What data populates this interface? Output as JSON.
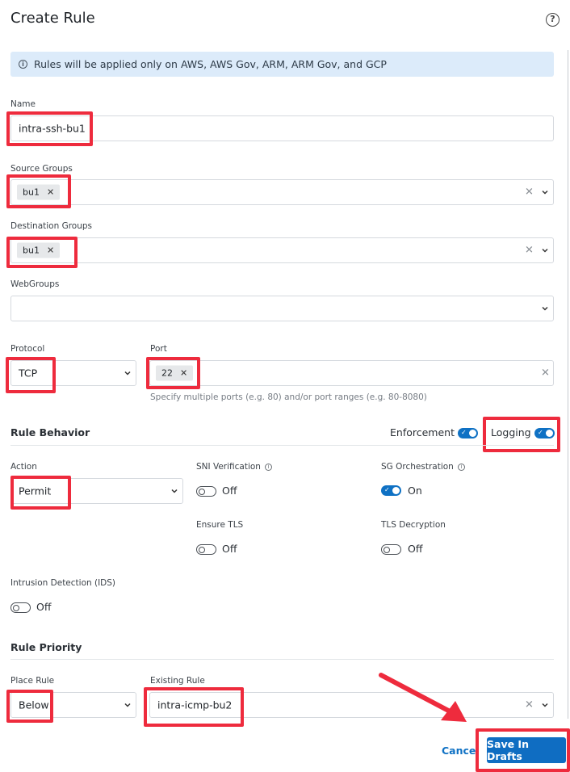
{
  "header": {
    "title": "Create Rule",
    "help_icon": "?"
  },
  "banner": {
    "icon": "info-icon",
    "text": "Rules will be applied only on AWS, AWS Gov, ARM, ARM Gov, and GCP"
  },
  "name": {
    "label": "Name",
    "value": "intra-ssh-bu1"
  },
  "source_groups": {
    "label": "Source Groups",
    "chips": [
      "bu1"
    ]
  },
  "destination_groups": {
    "label": "Destination Groups",
    "chips": [
      "bu1"
    ]
  },
  "webgroups": {
    "label": "WebGroups",
    "value": ""
  },
  "protocol": {
    "label": "Protocol",
    "value": "TCP"
  },
  "port": {
    "label": "Port",
    "chips": [
      "22"
    ],
    "hint": "Specify multiple ports (e.g. 80) and/or port ranges (e.g. 80-8080)"
  },
  "rule_behavior": {
    "title": "Rule Behavior",
    "enforcement": {
      "label": "Enforcement",
      "on": true
    },
    "logging": {
      "label": "Logging",
      "on": true
    }
  },
  "action": {
    "label": "Action",
    "value": "Permit"
  },
  "sni_verification": {
    "label": "SNI Verification",
    "state": "Off",
    "on": false
  },
  "sg_orchestration": {
    "label": "SG Orchestration",
    "state": "On",
    "on": true
  },
  "ensure_tls": {
    "label": "Ensure TLS",
    "state": "Off",
    "on": false
  },
  "tls_decryption": {
    "label": "TLS Decryption",
    "state": "Off",
    "on": false
  },
  "ids": {
    "label": "Intrusion Detection (IDS)",
    "state": "Off",
    "on": false
  },
  "rule_priority": {
    "title": "Rule Priority",
    "place_rule": {
      "label": "Place Rule",
      "value": "Below"
    },
    "existing_rule": {
      "label": "Existing Rule",
      "value": "intra-icmp-bu2"
    }
  },
  "footer": {
    "cancel_label": "Cancel",
    "save_label": "Save In Drafts"
  },
  "colors": {
    "accent": "#0f71c4",
    "highlight": "#ee2b3d",
    "banner_bg": "#dcebfa"
  }
}
